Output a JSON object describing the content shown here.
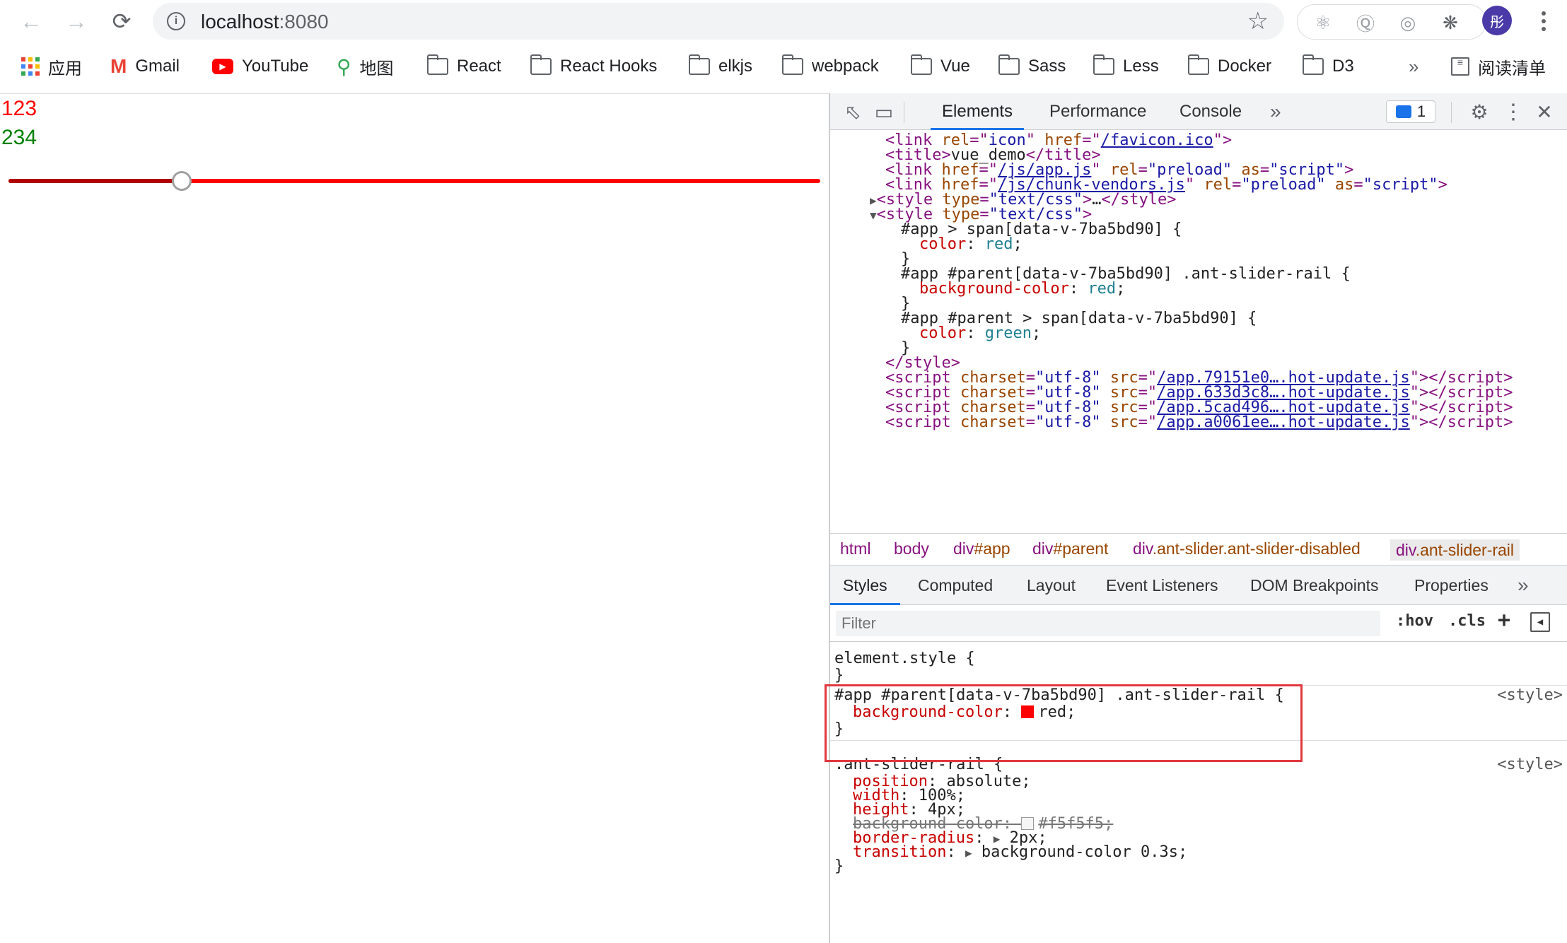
{
  "browser": {
    "url_host": "localhost",
    "url_port": ":8080",
    "profile_initial": "彤",
    "bookmarks": [
      {
        "label": "应用",
        "icon": "apps-icon"
      },
      {
        "label": "Gmail",
        "icon": "gmail-icon"
      },
      {
        "label": "YouTube",
        "icon": "youtube-icon"
      },
      {
        "label": "地图",
        "icon": "maps-icon"
      },
      {
        "label": "React",
        "icon": "folder-icon"
      },
      {
        "label": "React Hooks",
        "icon": "folder-icon"
      },
      {
        "label": "elkjs",
        "icon": "folder-icon"
      },
      {
        "label": "webpack",
        "icon": "folder-icon"
      },
      {
        "label": "Vue",
        "icon": "folder-icon"
      },
      {
        "label": "Sass",
        "icon": "folder-icon"
      },
      {
        "label": "Less",
        "icon": "folder-icon"
      },
      {
        "label": "Docker",
        "icon": "folder-icon"
      },
      {
        "label": "D3",
        "icon": "folder-icon"
      }
    ],
    "more_bookmarks": "»",
    "reading_list": "阅读清单"
  },
  "page": {
    "text1": "123",
    "text2": "234",
    "slider_value_fraction": 0.213,
    "rail_color": "#ff0000",
    "track_color": "#b00000"
  },
  "devtools": {
    "tabs": [
      "Elements",
      "Performance",
      "Console"
    ],
    "more": "»",
    "issues_count": "1",
    "dom_lines": {
      "l1": {
        "tag_open": "<link ",
        "a1": "rel",
        "v1": "\"icon\"",
        "a2": "href",
        "v2": "/favicon.ico",
        "end": ">"
      },
      "l2": {
        "open": "<title>",
        "text": "vue_demo",
        "close": "</title>"
      },
      "l3": {
        "a1": "href",
        "v1": "/js/app.js",
        "a2": "rel",
        "v2": "\"preload\"",
        "a3": "as",
        "v3": "\"script\""
      },
      "l4": {
        "a1": "href",
        "v1": "/js/chunk-vendors.js",
        "a2": "rel",
        "v2": "\"preload\"",
        "a3": "as",
        "v3": "\"script\""
      },
      "l5": {
        "text": "\"text/css\"",
        "ellipsis": "…"
      },
      "l6": {
        "text": "\"text/css\""
      },
      "css1_sel": "#app > span[data-v-7ba5bd90] {",
      "css1_prop": "color",
      "css1_val": "red",
      "css2_sel": "#app #parent[data-v-7ba5bd90] .ant-slider-rail {",
      "css2_prop": "background-color",
      "css2_val": "red",
      "css3_sel": "#app #parent > span[data-v-7ba5bd90] {",
      "css3_prop": "color",
      "css3_val": "green",
      "close_brace": "}",
      "style_close": "</style>",
      "scripts": [
        "/app.79151e0….hot-update.js",
        "/app.633d3c8….hot-update.js",
        "/app.5cad496….hot-update.js",
        "/app.a0061ee….hot-update.js"
      ]
    },
    "breadcrumbs": [
      {
        "tag": "html",
        "rest": ""
      },
      {
        "tag": "body",
        "rest": ""
      },
      {
        "tag": "div",
        "rest": "#app"
      },
      {
        "tag": "div",
        "rest": "#parent"
      },
      {
        "tag": "div",
        "rest": ".ant-slider.ant-slider-disabled"
      },
      {
        "tag": "div",
        "rest": ".ant-slider-rail"
      }
    ],
    "subtabs": [
      "Styles",
      "Computed",
      "Layout",
      "Event Listeners",
      "DOM Breakpoints",
      "Properties"
    ],
    "filter_placeholder": "Filter",
    "hov": ":hov",
    "cls": ".cls",
    "add": "+",
    "styles": {
      "element_style": "element.style {",
      "close": "}",
      "rule1_selector": "#app #parent[data-v-7ba5bd90] .ant-slider-rail {",
      "rule1_prop": "background-color",
      "rule1_value": "red;",
      "rule1_source": "<style>",
      "rule1_swatch": "#ff0000",
      "rule2_selector": ".ant-slider-rail {",
      "rule2_source": "<style>",
      "rule2_props": [
        {
          "name": "position",
          "value": "absolute;"
        },
        {
          "name": "width",
          "value": "100%;"
        },
        {
          "name": "height",
          "value": "4px;"
        },
        {
          "name": "background-color",
          "value": "#f5f5f5;"
        },
        {
          "name": "border-radius",
          "value": "2px;"
        },
        {
          "name": "transition",
          "value": "background-color 0.3s;"
        }
      ],
      "rule2_swatch": "#f5f5f5"
    }
  }
}
